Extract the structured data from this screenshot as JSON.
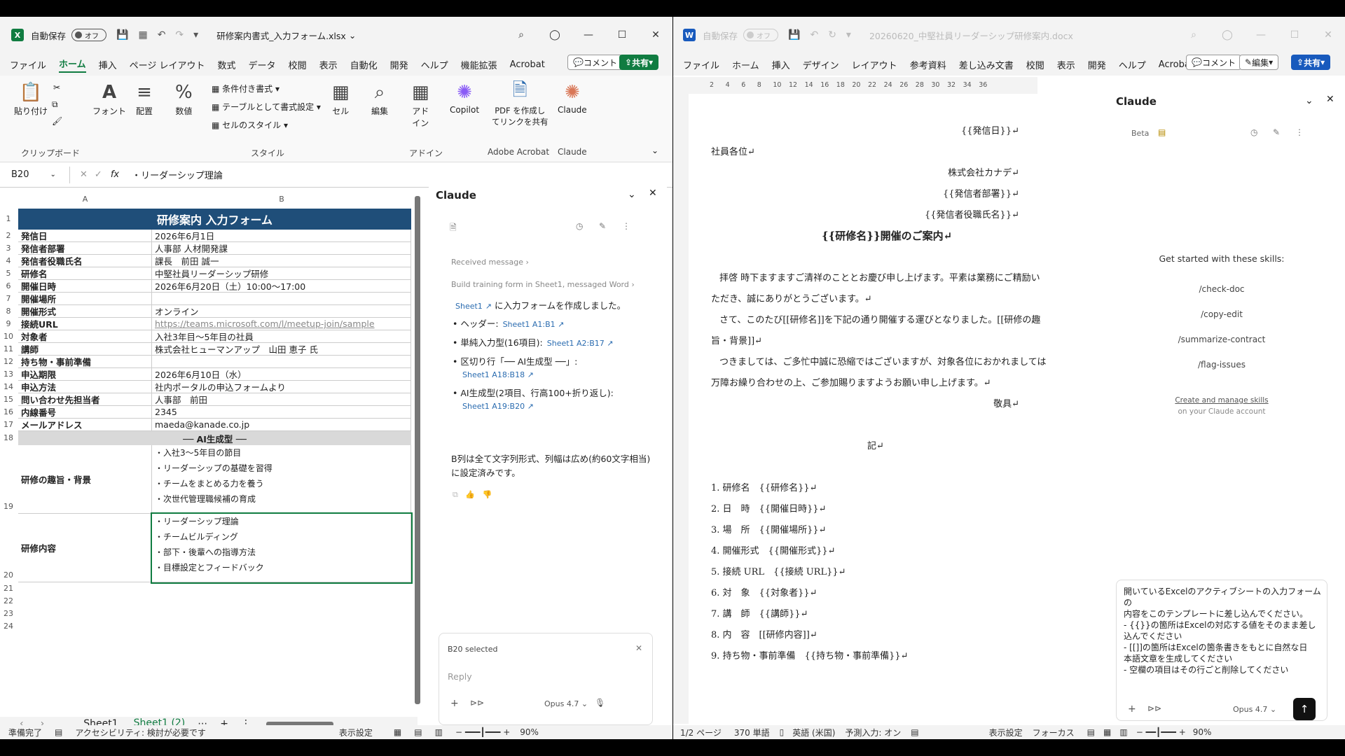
{
  "excel": {
    "autosave_label": "自動保存",
    "autosave_state": "オフ",
    "file_title": "研修案内書式_入力フォーム.xlsx",
    "menu": [
      "ファイル",
      "ホーム",
      "挿入",
      "ページ レイアウト",
      "数式",
      "データ",
      "校閲",
      "表示",
      "自動化",
      "開発",
      "ヘルプ",
      "機能拡張",
      "Acrobat"
    ],
    "comment_btn": "コメント",
    "share_btn": "共有",
    "ribbon": {
      "paste": "貼り付け",
      "clipboard_group": "クリップボード",
      "font": "フォント",
      "align": "配置",
      "number": "数値",
      "cond_format": "条件付き書式",
      "table_format": "テーブルとして書式設定",
      "cell_style": "セルのスタイル",
      "style_group": "スタイル",
      "cell": "セル",
      "edit": "編集",
      "addin": "アド\nイン",
      "addin_group": "アドイン",
      "copilot": "Copilot",
      "pdf_share": "PDF を作成し\nてリンクを共有",
      "adobe_group": "Adobe Acrobat",
      "claude": "Claude",
      "claude_group": "Claude"
    },
    "namebox": "B20",
    "fx": "fx",
    "formula": "・リーダーシップ理論",
    "col_a": "A",
    "col_b": "B",
    "header": "研修案内 入力フォーム",
    "rows": [
      {
        "n": "2",
        "a": "発信日",
        "b": "2026年6月1日"
      },
      {
        "n": "3",
        "a": "発信者部署",
        "b": "人事部 人材開発課"
      },
      {
        "n": "4",
        "a": "発信者役職氏名",
        "b": "課長　前田 誠一"
      },
      {
        "n": "5",
        "a": "研修名",
        "b": "中堅社員リーダーシップ研修"
      },
      {
        "n": "6",
        "a": "開催日時",
        "b": "2026年6月20日（土）10:00～17:00"
      },
      {
        "n": "7",
        "a": "開催場所",
        "b": ""
      },
      {
        "n": "8",
        "a": "開催形式",
        "b": "オンライン"
      },
      {
        "n": "9",
        "a": "接続URL",
        "b": "https://teams.microsoft.com/l/meetup-join/sample"
      },
      {
        "n": "10",
        "a": "対象者",
        "b": "入社3年目～5年目の社員"
      },
      {
        "n": "11",
        "a": "講師",
        "b": "株式会社ヒューマンアップ　山田 恵子 氏"
      },
      {
        "n": "12",
        "a": "持ち物・事前準備",
        "b": ""
      },
      {
        "n": "13",
        "a": "申込期限",
        "b": "2026年6月10日（水）"
      },
      {
        "n": "14",
        "a": "申込方法",
        "b": "社内ポータルの申込フォームより"
      },
      {
        "n": "15",
        "a": "問い合わせ先担当者",
        "b": "人事部　前田"
      },
      {
        "n": "16",
        "a": "内線番号",
        "b": "2345"
      },
      {
        "n": "17",
        "a": "メールアドレス",
        "b": "maeda@kanade.co.jp"
      }
    ],
    "separator": "── AI生成型 ──",
    "row19_label": "研修の趣旨・背景",
    "row19_lines": [
      "・入社3～5年目の節目",
      "・リーダーシップの基礎を習得",
      "・チームをまとめる力を養う",
      "・次世代管理職候補の育成"
    ],
    "row20_label": "研修内容",
    "row20_lines": [
      "・リーダーシップ理論",
      "・チームビルディング",
      "・部下・後輩への指導方法",
      "・目標設定とフィードバック"
    ],
    "row_numbers_extra": [
      "1",
      "18",
      "19",
      "20",
      "21",
      "22",
      "23",
      "24"
    ],
    "sheets": [
      "Sheet1",
      "Sheet1 (2)"
    ],
    "status_ready": "準備完了",
    "status_access": "アクセシビリティ: 検討が必要です",
    "status_view": "表示設定",
    "zoom": "90%",
    "claude": {
      "title": "Claude",
      "received": "Received message",
      "build": "Build training form in Sheet1, messaged Word",
      "intro_link": "Sheet1",
      "intro_text": "に入力フォームを作成しました。",
      "bullets": [
        {
          "text": "ヘッダー:",
          "link": "Sheet1 A1:B1"
        },
        {
          "text": "単純入力型(16項目):",
          "link": "Sheet1 A2:B17"
        },
        {
          "text": "区切り行「── AI生成型 ──」:",
          "link": "Sheet1 A18:B18"
        },
        {
          "text": "AI生成型(2項目、行高100+折り返し):",
          "link": "Sheet1 A19:B20"
        }
      ],
      "summary": "B列は全て文字列形式、列幅は広め(約60文字相当)に設定済みです。",
      "selected": "B20 selected",
      "reply_placeholder": "Reply",
      "model": "Opus 4.7"
    }
  },
  "word": {
    "autosave_label": "自動保存",
    "autosave_state": "オフ",
    "file_title": "20260620_中堅社員リーダーシップ研修案内.docx",
    "menu": [
      "ファイル",
      "ホーム",
      "挿入",
      "デザイン",
      "レイアウト",
      "参考資料",
      "差し込み文書",
      "校閲",
      "表示",
      "開発",
      "ヘルプ",
      "Acrobat"
    ],
    "comment_btn": "コメント",
    "edit_btn": "編集",
    "share_btn": "共有",
    "ruler": [
      "2",
      "4",
      "6",
      "8",
      "10",
      "12",
      "14",
      "16",
      "18",
      "20",
      "22",
      "24",
      "26",
      "28",
      "30",
      "32",
      "34",
      "36"
    ],
    "doc": {
      "date": "{{発信日}}↵",
      "to": "社員各位↵",
      "company": "株式会社カナデ↵",
      "dept": "{{発信者部署}}↵",
      "sender": "{{発信者役職氏名}}↵",
      "title": "{{研修名}}開催のご案内↵",
      "p1a": "拝啓 時下ますますご清祥のこととお慶び申し上げます。平素は業務にご精励い",
      "p1b": "ただき、誠にありがとうございます。↵",
      "p2a": "さて、このたび[[研修名]]を下記の通り開催する運びとなりました。[[研修の趣",
      "p2b": "旨・背景]]↵",
      "p3a": "つきましては、ご多忙中誠に恐縮ではございますが、対象各位におかれましては",
      "p3b": "万障お繰り合わせの上、ご参加賜りますようお願い申し上げます。↵",
      "closing": "敬具↵",
      "ki": "記↵",
      "items": [
        "1. 研修名　{{研修名}}↵",
        "2. 日　時　{{開催日時}}↵",
        "3. 場　所　{{開催場所}}↵",
        "4. 開催形式　{{開催形式}}↵",
        "5. 接続 URL　{{接続 URL}}↵",
        "6. 対　象　{{対象者}}↵",
        "7. 講　師　{{講師}}↵",
        "8. 内　容　[[研修内容]]↵",
        "9. 持ち物・事前準備　{{持ち物・事前準備}}↵"
      ]
    },
    "claude": {
      "title": "Claude",
      "beta": "Beta",
      "get_started": "Get started with these skills:",
      "skills": [
        "/check-doc",
        "/copy-edit",
        "/summarize-contract",
        "/flag-issues"
      ],
      "manage1": "Create and manage skills",
      "manage2": "on your Claude account",
      "prompt_lines": [
        "開いているExcelのアクティブシートの入力フォームの",
        "内容をこのテンプレートに差し込んでください。",
        "- {{}}の箇所はExcelの対応する値をそのまま差し",
        "込んでください",
        "- [[]]の箇所はExcelの箇条書きをもとに自然な日",
        "本語文章を生成してください",
        "- 空欄の項目はその行ごと削除してください"
      ],
      "model": "Opus 4.7"
    },
    "status_page": "1/2 ページ",
    "status_words": "370 単語",
    "status_lang": "英語 (米国)",
    "status_predict": "予測入力: オン",
    "status_view": "表示設定",
    "status_focus": "フォーカス",
    "zoom": "90%"
  },
  "colors": {
    "excel_green": "#107c41",
    "word_blue": "#185abd",
    "header_blue": "#1f4e79",
    "link": "#2b6cb0"
  }
}
